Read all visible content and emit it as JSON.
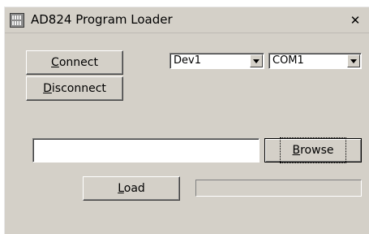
{
  "window": {
    "title": "AD824 Program Loader",
    "close_glyph": "✕"
  },
  "connect_button": {
    "label_accel": "C",
    "label_rest": "onnect"
  },
  "disconnect_button": {
    "label_accel": "D",
    "label_rest": "isconnect"
  },
  "device_select": {
    "selected": "Dev1",
    "icon": "chevron-down-icon"
  },
  "port_select": {
    "selected": "COM1",
    "icon": "chevron-down-icon"
  },
  "file_path": {
    "value": "",
    "placeholder": ""
  },
  "browse_button": {
    "label_accel": "B",
    "label_rest": "rowse"
  },
  "load_button": {
    "label_accel": "L",
    "label_rest": "oad"
  },
  "load_progress": {
    "fraction": 0
  },
  "colors": {
    "window_bg": "#d4d0c8",
    "field_bg": "#ffffff",
    "progress_fill": "#000080"
  }
}
